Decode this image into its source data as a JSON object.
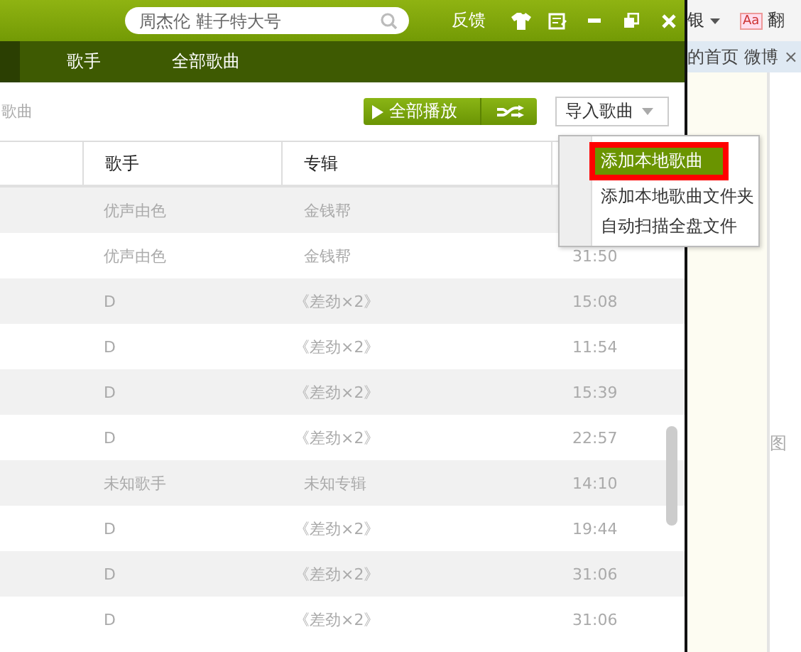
{
  "search": {
    "placeholder": "周杰伦 鞋子特大号"
  },
  "title_bar": {
    "feedback": "反馈"
  },
  "nav": [
    "歌手",
    "全部歌曲"
  ],
  "toolbar": {
    "count_label": "歌曲",
    "play_all": "全部播放",
    "import": "导入歌曲"
  },
  "table": {
    "columns": [
      "歌手",
      "专辑"
    ],
    "rows": [
      {
        "singer": "优声由色",
        "album": "金钱帮"
      },
      {
        "singer": "优声由色",
        "album": "金钱帮",
        "time": "31:50"
      },
      {
        "singer": "D",
        "album": "《差劲×2》",
        "time": "15:08"
      },
      {
        "singer": "D",
        "album": "《差劲×2》",
        "time": "11:54"
      },
      {
        "singer": "D",
        "album": "《差劲×2》",
        "time": "15:39"
      },
      {
        "singer": "D",
        "album": "《差劲×2》",
        "time": "22:57"
      },
      {
        "singer": "未知歌手",
        "album": "未知专辑",
        "time": "14:10"
      },
      {
        "singer": "D",
        "album": "《差劲×2》",
        "time": "19:44"
      },
      {
        "singer": "D",
        "album": "《差劲×2》",
        "time": "31:06"
      },
      {
        "singer": "D",
        "album": "《差劲×2》",
        "time": "31:06"
      }
    ]
  },
  "import_menu": [
    {
      "label": "添加本地歌曲",
      "selected": true
    },
    {
      "label": "添加本地歌曲文件夹",
      "selected": false
    },
    {
      "label": "自动扫描全盘文件",
      "selected": false
    }
  ],
  "browser": {
    "menu_text": "银",
    "translate_badge": "Aa",
    "translate": "翻",
    "tab": "的首页 微博",
    "tab_close": "×",
    "side_text": "图"
  }
}
